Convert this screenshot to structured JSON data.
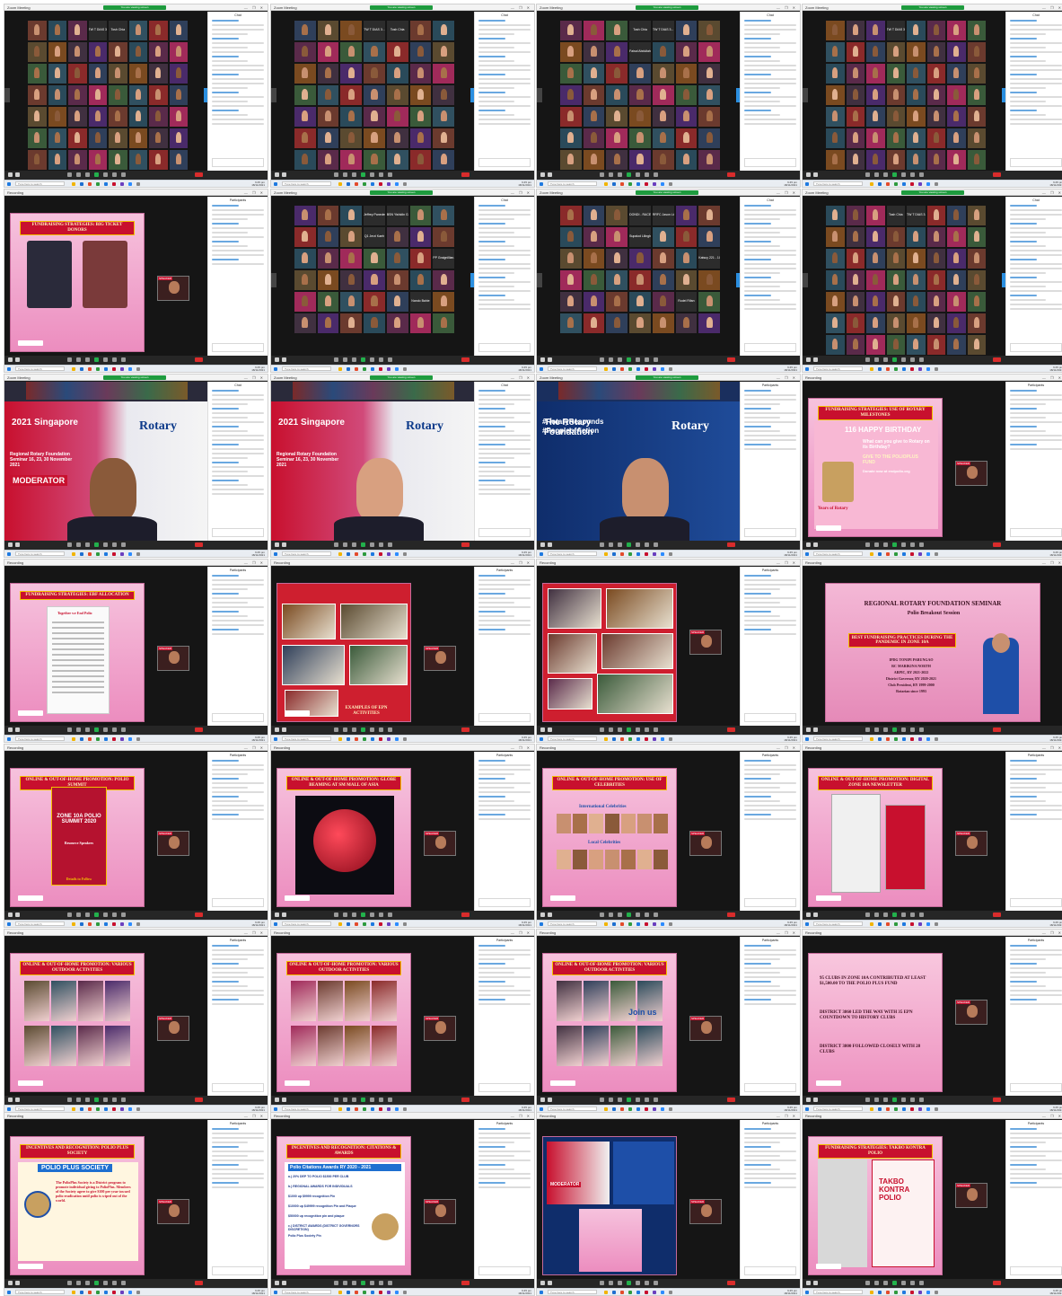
{
  "app": {
    "window_title": "Zoom Meeting",
    "secondary_title": "Recording",
    "share_banner": "You are viewing screen",
    "search_placeholder": "Type here to search",
    "clock_time": "9:45 pm",
    "clock_date": "18/11/2021",
    "chat_header": "Chat",
    "participants_header": "Participants"
  },
  "screens": [
    {
      "type": "gallery",
      "cols": 8,
      "rows": 7,
      "names": [
        "TW T DIAS 3...",
        "Tosh Chia"
      ],
      "sidebar": "chat"
    },
    {
      "type": "gallery",
      "cols": 7,
      "rows": 7,
      "names": [
        "TW T DIAS 3...",
        "Tosh Chia"
      ],
      "sidebar": "chat"
    },
    {
      "type": "gallery",
      "cols": 7,
      "rows": 7,
      "names": [
        "Tosh Chia",
        "TW T DIAS 3...",
        "Faisal Abdullah"
      ],
      "sidebar": "chat"
    },
    {
      "type": "gallery",
      "cols": 8,
      "rows": 7,
      "names": [
        "TW T DIAS 3..."
      ],
      "sidebar": "chat"
    },
    {
      "type": "slide",
      "title": "FUNDRAISING STRATEGIES: BIG TICKET DONORS",
      "variant": "donors",
      "sidebar": "participants"
    },
    {
      "type": "gallery",
      "cols": 7,
      "rows": 6,
      "names": [
        "Jeffrey Panedero",
        "BSN Yishidin Ga...",
        "Q1 Jerzi Kaeh",
        "PP Graignillian...",
        "Nando Bahie",
        "DEXIR 2012 Mat...",
        "Rotary Secret Gi...",
        "RC Tuller Family",
        "Sapolon Lillingh...",
        "DONDI - RACEY..",
        "RRFC Jason Lim",
        "Rodel"
      ],
      "sidebar": "chat"
    },
    {
      "type": "gallery",
      "cols": 7,
      "rows": 6,
      "names": [
        "DONDI - RACEY...",
        "RRFC Jason Lim",
        "Supalod Lilingh...",
        "Katsuy 221 - 1G",
        "Rodel Rifan",
        "Jaime Coral"
      ],
      "sidebar": "chat"
    },
    {
      "type": "gallery",
      "cols": 8,
      "rows": 7,
      "names": [
        "Tosh Chia",
        "TW T DIAS 3..."
      ],
      "sidebar": "chat"
    },
    {
      "type": "video",
      "caption": "MODERATOR",
      "event": "Regional Rotary Foundation Seminar 16, 23, 30 November 2021",
      "brand": "Rotary",
      "year": "2021 Singapore",
      "sidebar": "chat"
    },
    {
      "type": "video",
      "caption": "",
      "event": "Regional Rotary Foundation Seminar 16, 23, 30 November 2021",
      "brand": "Rotary",
      "year": "2021 Singapore",
      "sidebar": "chat"
    },
    {
      "type": "video",
      "caption": "#RotaryResponds #PeopleofAction",
      "event": "",
      "brand": "Rotary",
      "year": "The Rotary Foundation",
      "sidebar": "participants"
    },
    {
      "type": "slide",
      "title": "FUNDRAISING STRATEGIES: USE OF ROTARY MILESTONES",
      "variant": "birthday",
      "body": [
        "116 HAPPY BIRTHDAY",
        "What can you give to Rotary on its Birthday?",
        "GIVE TO THE POLIOPLUS FUND",
        "Donate now at endpolio.org",
        "Years of Rotary"
      ],
      "sidebar": "participants"
    },
    {
      "type": "slide",
      "title": "FUNDRAISING STRATEGIES: EBF ALLOCATION",
      "variant": "document",
      "body": [
        "Together we End Polio"
      ],
      "sidebar": "participants"
    },
    {
      "type": "slide",
      "title": "EXAMPLES OF EPN ACTIVITIES",
      "variant": "photos",
      "sidebar": "participants"
    },
    {
      "type": "slide",
      "title": "",
      "variant": "photos2",
      "sidebar": "participants"
    },
    {
      "type": "slide",
      "title": "REGIONAL ROTARY FOUNDATION SEMINAR",
      "variant": "speaker",
      "body": [
        "Polio Breakout Session",
        "BEST FUNDRAISING PRACTICES DURING THE PANDEMIC IN ZONE 10A",
        "IPDG TONIPI PARUNGAO",
        "RC MARIKINA NORTH",
        "ARPIC, RY 2021-2022",
        "District Governor, RY 2020-2021",
        "Club President, RY 1999-2000",
        "Rotarian since 1993"
      ],
      "sidebar": "none"
    },
    {
      "type": "slide",
      "title": "ONLINE & OUT-OF-HOME PROMOTION: POLIO SUMMIT",
      "variant": "summit",
      "body": [
        "ZONE 10A POLIO SUMMIT 2020",
        "Resource Speakers",
        "Details to Follow"
      ],
      "sidebar": "participants"
    },
    {
      "type": "slide",
      "title": "ONLINE & OUT-OF-HOME PROMOTION: GLOBE BEAMING AT SM MALL OF ASIA",
      "variant": "globe",
      "sidebar": "participants"
    },
    {
      "type": "slide",
      "title": "ONLINE & OUT-OF-HOME PROMOTION: USE OF CELEBRITIES",
      "variant": "celebs",
      "body": [
        "International Celebrities",
        "Local Celebrities"
      ],
      "sidebar": "participants"
    },
    {
      "type": "slide",
      "title": "ONLINE & OUT-OF-HOME PROMOTION: DIGITAL ZONE 10A NEWSLETTER",
      "variant": "newsletter",
      "sidebar": "participants"
    },
    {
      "type": "slide",
      "title": "ONLINE & OUT-OF-HOME PROMOTION: VARIOUS OUTDOOR ACTIVITIES",
      "variant": "collage",
      "sidebar": "participants"
    },
    {
      "type": "slide",
      "title": "ONLINE & OUT-OF-HOME PROMOTION: VARIOUS OUTDOOR ACTIVITIES",
      "variant": "collage",
      "sidebar": "participants"
    },
    {
      "type": "slide",
      "title": "ONLINE & OUT-OF-HOME PROMOTION: VARIOUS OUTDOOR ACTIVITIES",
      "variant": "joinus",
      "body": [
        "Join us"
      ],
      "sidebar": "participants"
    },
    {
      "type": "slide",
      "title": "",
      "variant": "bullets",
      "body": [
        "95 CLUBS IN ZONE 10A CONTRIBUTED AT LEAST $1,500.00 TO THE POLIO PLUS FUND",
        "DISTRICT 3860 LED THE WAY WITH 35 EPN COUNTDOWN TO HISTORY CLUBS",
        "DISTRICT 3800 FOLLOWED CLOSELY WITH 28 CLUBS"
      ],
      "sidebar": "participants"
    },
    {
      "type": "slide",
      "title": "INCENTIVES AND RECOGNITION: POLIO PLUS SOCIETY",
      "variant": "society",
      "body": [
        "POLIO PLUS SOCIETY",
        "The PolioPlus Society is a District program to promote individual giving to PolioPlus. Members of the Society agree to give $100 per year toward polio eradication until polio is wiped out of the world."
      ],
      "sidebar": "participants"
    },
    {
      "type": "slide",
      "title": "INCENTIVES AND RECOGNITION: CITATIONS & AWARDS",
      "variant": "citations",
      "body": [
        "Polio Citations Awards RY 2020 - 2021",
        "a.) 20% DEP TO POLIO $1500 PER CLUB",
        "b.) REGIONAL AWARDS FOR INDIVIDUALS",
        "$1000 up $9999 recognition Pin",
        "$10000 up $49999 recognition Pin and Plaque",
        "$50000 up recognition pin and plaque",
        "c.) DISTRICT AWARDS (DISTRICT GOVERNORS DISCRETION)",
        "Polio Plus Society Pin"
      ],
      "sidebar": "participants"
    },
    {
      "type": "composite",
      "caption": "MODERATOR",
      "sidebar": "participants"
    },
    {
      "type": "slide",
      "title": "FUNDRAISING STRATEGIES: TAKBO KONTRA POLIO",
      "variant": "takbo",
      "body": [
        "TAKBO KONTRA POLIO"
      ],
      "sidebar": "participants"
    }
  ]
}
